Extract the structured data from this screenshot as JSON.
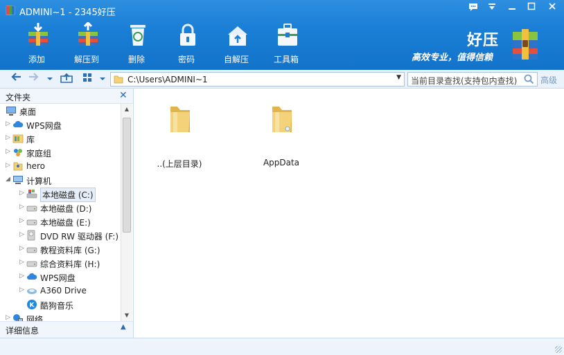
{
  "window": {
    "title": "ADMINI~1 - 2345好压",
    "controls": [
      "chat-icon",
      "menu-icon",
      "minimize-icon",
      "maximize-icon",
      "close-icon"
    ]
  },
  "toolbar": {
    "items": [
      {
        "label": "添加",
        "icon": "add-archive-icon"
      },
      {
        "label": "解压到",
        "icon": "extract-to-icon"
      },
      {
        "label": "删除",
        "icon": "trash-icon"
      },
      {
        "label": "密码",
        "icon": "lock-icon"
      },
      {
        "label": "自解压",
        "icon": "self-extract-icon"
      },
      {
        "label": "工具箱",
        "icon": "toolbox-icon"
      }
    ]
  },
  "brand": {
    "name": "好压",
    "slogan": "高效专业，值得信赖"
  },
  "navbar": {
    "path": "C:\\Users\\ADMINI~1",
    "search_placeholder": "当前目录查找(支持包内查找)",
    "advanced_label": "高级"
  },
  "left_pane": {
    "header": "文件夹",
    "details_label": "详细信息",
    "tree": [
      {
        "label": "桌面",
        "icon": "desktop-icon",
        "level": 0,
        "arrow": ""
      },
      {
        "label": "WPS网盘",
        "icon": "cloud-icon",
        "level": 0,
        "arrow": "right"
      },
      {
        "label": "库",
        "icon": "library-icon",
        "level": 0,
        "arrow": "right"
      },
      {
        "label": "家庭组",
        "icon": "homegroup-icon",
        "level": 0,
        "arrow": "right"
      },
      {
        "label": "hero",
        "icon": "user-folder-icon",
        "level": 0,
        "arrow": "right"
      },
      {
        "label": "计算机",
        "icon": "computer-icon",
        "level": 0,
        "arrow": "down"
      },
      {
        "label": "本地磁盘 (C:)",
        "icon": "system-drive-icon",
        "level": 1,
        "arrow": "right",
        "selected": true
      },
      {
        "label": "本地磁盘 (D:)",
        "icon": "drive-icon",
        "level": 1,
        "arrow": "right"
      },
      {
        "label": "本地磁盘 (E:)",
        "icon": "drive-icon",
        "level": 1,
        "arrow": "right"
      },
      {
        "label": "DVD RW 驱动器 (F:)",
        "icon": "dvd-drive-icon",
        "level": 1,
        "arrow": "right"
      },
      {
        "label": "教程资料库 (G:)",
        "icon": "drive-icon",
        "level": 1,
        "arrow": "right"
      },
      {
        "label": "综合资料库 (H:)",
        "icon": "drive-icon",
        "level": 1,
        "arrow": "right"
      },
      {
        "label": "WPS网盘",
        "icon": "cloud-icon",
        "level": 1,
        "arrow": "right"
      },
      {
        "label": "A360 Drive",
        "icon": "a360-icon",
        "level": 1,
        "arrow": "right"
      },
      {
        "label": "酷狗音乐",
        "icon": "kugou-icon",
        "level": 1,
        "arrow": ""
      },
      {
        "label": "网络",
        "icon": "network-icon",
        "level": 0,
        "arrow": "right"
      }
    ]
  },
  "files": [
    {
      "name": "..(上层目录)",
      "icon": "folder-icon"
    },
    {
      "name": "AppData",
      "icon": "folder-icon"
    }
  ],
  "colors": {
    "toolbar_blue": "#1a7fd6",
    "nav_background": "#eaf2fb",
    "folder_yellow": "#f3d27a",
    "selection": "#e5eef9"
  }
}
